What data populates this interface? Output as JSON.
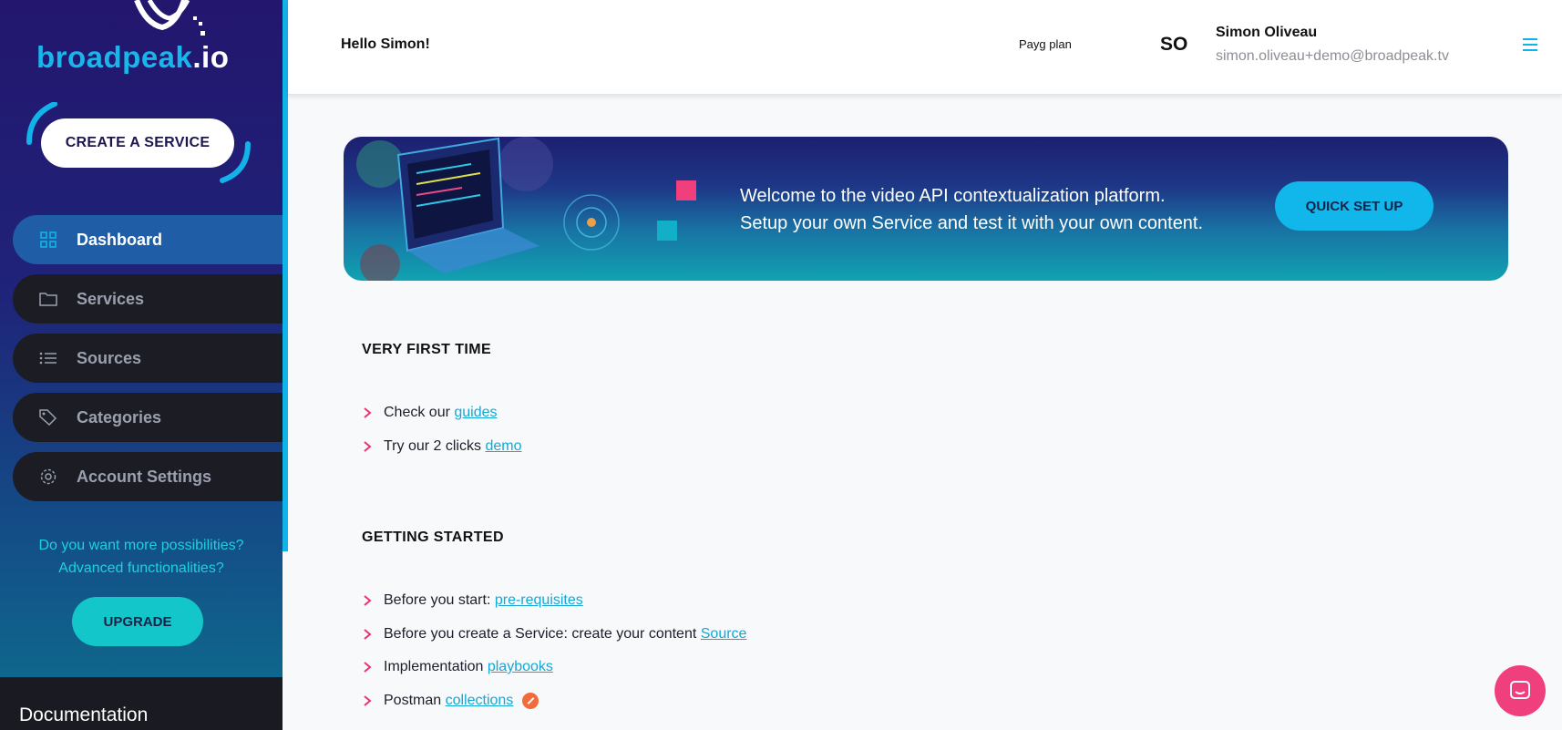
{
  "sidebar": {
    "logo_main": "broadpeak",
    "logo_suffix": ".io",
    "create_label": "CREATE A SERVICE",
    "nav": [
      {
        "label": "Dashboard",
        "icon": "dashboard-grid-icon",
        "active": true
      },
      {
        "label": "Services",
        "icon": "folder-icon",
        "active": false
      },
      {
        "label": "Sources",
        "icon": "list-icon",
        "active": false
      },
      {
        "label": "Categories",
        "icon": "tags-icon",
        "active": false
      },
      {
        "label": "Account Settings",
        "icon": "gear-icon",
        "active": false
      }
    ],
    "upsell_line1": "Do you want more possibilities?",
    "upsell_line2": "Advanced functionalities?",
    "upgrade_label": "UPGRADE",
    "docs_label": "Documentation"
  },
  "header": {
    "greeting": "Hello Simon!",
    "plan": "Payg plan",
    "initials": "SO",
    "user_name": "Simon Oliveau",
    "user_email": "simon.oliveau+demo@broadpeak.tv"
  },
  "banner": {
    "line1": "Welcome to the video API contextualization platform.",
    "line2": "Setup your own Service and test it with your own content.",
    "cta": "QUICK SET UP"
  },
  "first_time": {
    "title": "VERY FIRST TIME",
    "items": [
      {
        "text": "Check our ",
        "link": "guides"
      },
      {
        "text": "Try our 2 clicks ",
        "link": "demo"
      }
    ]
  },
  "getting_started": {
    "title": "GETTING STARTED",
    "items": [
      {
        "text": "Before you start: ",
        "link": "pre-requisites"
      },
      {
        "text": "Before you create a Service: create your content ",
        "link": "Source"
      },
      {
        "text": "Implementation ",
        "link": "playbooks"
      },
      {
        "text": "Postman ",
        "link": "collections"
      }
    ]
  },
  "colors": {
    "accent": "#12b3e8",
    "link": "#14a8d6",
    "bullet": "#e8336b",
    "chat": "#ef3f7d"
  }
}
